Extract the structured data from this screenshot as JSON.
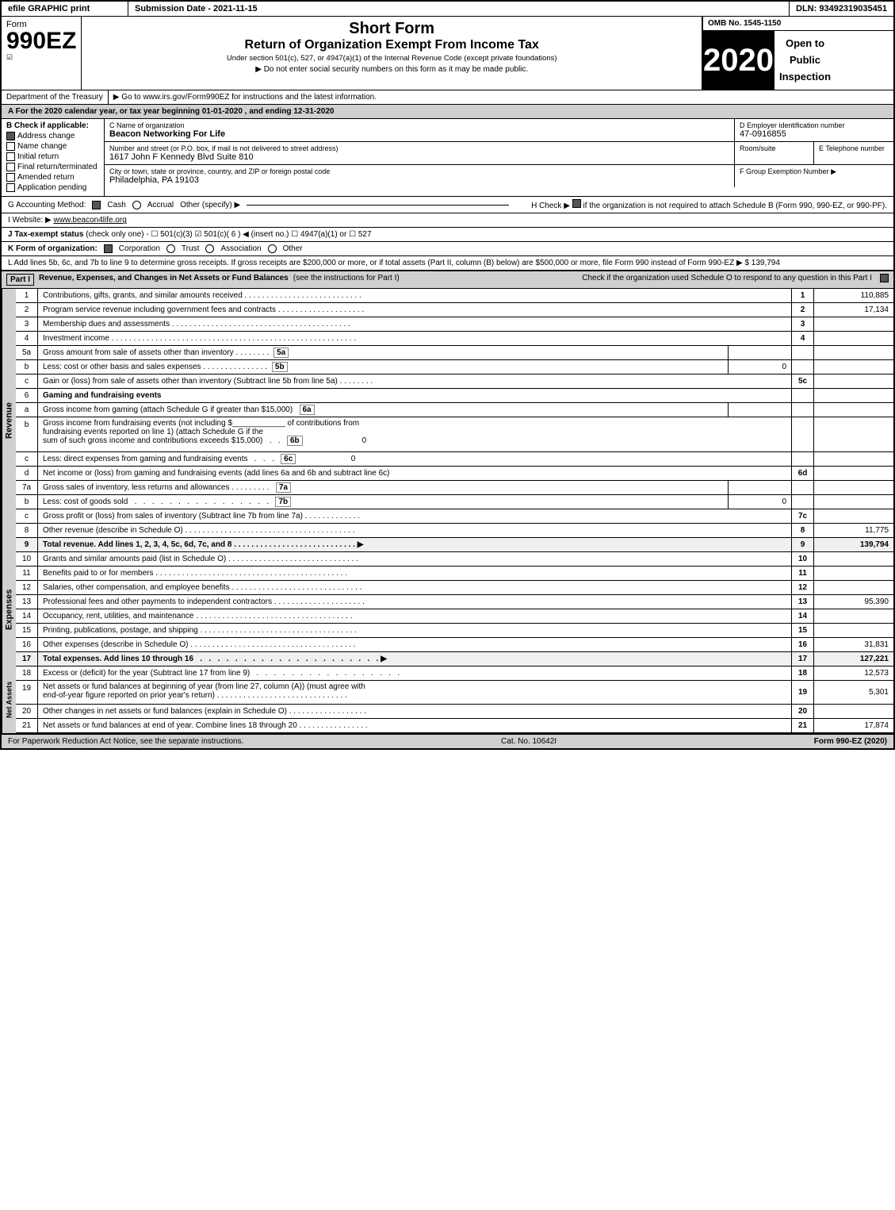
{
  "header": {
    "efile_label": "efile GRAPHIC print",
    "submission_label": "Submission Date - 2021-11-15",
    "dln_label": "DLN: 93492319035451"
  },
  "form": {
    "number": "990EZ",
    "short_form": "Short Form",
    "subtitle": "Return of Organization Exempt From Income Tax",
    "under_section": "Under section 501(c), 527, or 4947(a)(1) of the Internal Revenue Code (except private foundations)",
    "ssn_notice": "▶ Do not enter social security numbers on this form as it may be made public.",
    "instructions_link": "▶ Go to www.irs.gov/Form990EZ for instructions and the latest information.",
    "omb": "OMB No. 1545-1150",
    "year": "2020",
    "open_to_public": "Open to\nPublic\nInspection",
    "dept_treasury": "Department of the Treasury",
    "tax_year_line": "A For the 2020 calendar year, or tax year beginning 01-01-2020 , and ending 12-31-2020",
    "check_if": "B Check if applicable:",
    "address_change": "Address change",
    "name_change": "Name change",
    "initial_return": "Initial return",
    "final_return": "Final return/terminated",
    "amended_return": "Amended return",
    "application_pending": "Application pending",
    "c_name_label": "C Name of organization",
    "org_name": "Beacon Networking For Life",
    "d_ein_label": "D Employer identification number",
    "ein": "47-0916855",
    "address_label": "Number and street (or P.O. box, if mail is not delivered to street address)",
    "address_value": "1617 John F Kennedy Blvd Suite 810",
    "room_label": "Room/suite",
    "phone_label": "E Telephone number",
    "city_label": "City or town, state or province, country, and ZIP or foreign postal code",
    "city_value": "Philadelphia, PA  19103",
    "group_label": "F Group Exemption Number",
    "group_arrow": "▶",
    "accounting_label": "G Accounting Method:",
    "cash_label": "Cash",
    "accrual_label": "Accrual",
    "other_specify": "Other (specify) ▶",
    "h_check": "H Check ▶",
    "h_desc": "if the organization is not required to attach Schedule B (Form 990, 990-EZ, or 990-PF).",
    "website_label": "I Website: ▶",
    "website_value": "www.beacon4life.org",
    "tax_status_label": "J Tax-exempt status",
    "tax_status_desc": "(check only one) - ☐ 501(c)(3)  ☑ 501(c)( 6 ) ◀ (insert no.)  ☐ 4947(a)(1) or  ☐ 527",
    "form_org_label": "K Form of organization:",
    "corp_label": "Corporation",
    "trust_label": "Trust",
    "assoc_label": "Association",
    "other_label": "Other",
    "gross_receipt_line": "L Add lines 5b, 6c, and 7b to line 9 to determine gross receipts. If gross receipts are $200,000 or more, or if total assets (Part II, column (B) below) are $500,000 or more, file Form 990 instead of Form 990-EZ",
    "gross_receipt_amount": "▶ $ 139,794"
  },
  "part1": {
    "title": "Part I",
    "title_desc": "Revenue, Expenses, and Changes in Net Assets or Fund Balances",
    "title_see": "(see the instructions for Part I)",
    "schedule_o_check": "Check if the organization used Schedule O to respond to any question in this Part I",
    "lines": [
      {
        "num": "1",
        "desc": "Contributions, gifts, grants, and similar amounts received . . . . . . . . . . . . . . . . . . . . . . . . . . .",
        "line_ref": "1",
        "amount": "110,885"
      },
      {
        "num": "2",
        "desc": "Program service revenue including government fees and contracts . . . . . . . . . . . . . . . . . . . .",
        "line_ref": "2",
        "amount": "17,134"
      },
      {
        "num": "3",
        "desc": "Membership dues and assessments . . . . . . . . . . . . . . . . . . . . . . . . . . . . . . . . . . . . . . . . .",
        "line_ref": "3",
        "amount": ""
      },
      {
        "num": "4",
        "desc": "Investment income . . . . . . . . . . . . . . . . . . . . . . . . . . . . . . . . . . . . . . . . . . . . . . . . . . . . . . . .",
        "line_ref": "4",
        "amount": ""
      },
      {
        "num": "5a",
        "sub": "5a",
        "desc": "Gross amount from sale of assets other than inventory . . . . . . . .",
        "sub_amount": "",
        "line_ref": "",
        "amount": ""
      },
      {
        "num": "b",
        "sub": "5b",
        "desc": "Less: cost or other basis and sales expenses . . . . . . . . . . . . . . .",
        "sub_amount": "0",
        "line_ref": "",
        "amount": ""
      },
      {
        "num": "c",
        "desc": "Gain or (loss) from sale of assets other than inventory (Subtract line 5b from line 5a) . . . . . . . .",
        "line_ref": "5c",
        "amount": ""
      },
      {
        "num": "6",
        "desc": "Gaming and fundraising events",
        "line_ref": "",
        "amount": ""
      },
      {
        "num": "a",
        "sub": "6a",
        "desc": "Gross income from gaming (attach Schedule G if greater than $15,000)",
        "sub_amount": "",
        "line_ref": "",
        "amount": ""
      },
      {
        "num": "b",
        "desc": "Gross income from fundraising events (not including $____________ of contributions from fundraising events reported on line 1) (attach Schedule G if the sum of such gross income and contributions exceeds $15,000)   .   .",
        "sub": "6b",
        "sub_amount": "0",
        "line_ref": "",
        "amount": ""
      },
      {
        "num": "c",
        "sub": "6c",
        "desc": "Less: direct expenses from gaming and fundraising events   .   .   .",
        "sub_amount": "0",
        "line_ref": "",
        "amount": ""
      },
      {
        "num": "d",
        "desc": "Net income or (loss) from gaming and fundraising events (add lines 6a and 6b and subtract line 6c)",
        "line_ref": "6d",
        "amount": ""
      },
      {
        "num": "7a",
        "sub": "7a",
        "desc": "Gross sales of inventory, less returns and allowances . . . . . . . . .",
        "sub_amount": "",
        "line_ref": "",
        "amount": ""
      },
      {
        "num": "b",
        "sub": "7b",
        "desc": "Less: cost of goods sold    .   .   .   .   .   .   .   .   .   .   .   .   .   .   .   .   .   .",
        "sub_amount": "0",
        "line_ref": "",
        "amount": ""
      },
      {
        "num": "c",
        "desc": "Gross profit or (loss) from sales of inventory (Subtract line 7b from line 7a)  . . . . . . . . . . . . .",
        "line_ref": "7c",
        "amount": ""
      },
      {
        "num": "8",
        "desc": "Other revenue (describe in Schedule O) . . . . . . . . . . . . . . . . . . . . . . . . . . . . . . . . . . . . . . .",
        "line_ref": "8",
        "amount": "11,775"
      },
      {
        "num": "9",
        "desc": "Total revenue. Add lines 1, 2, 3, 4, 5c, 6d, 7c, and 8  . . . . . . . . . . . . . . . . . . . . . . . . . . . .",
        "line_ref": "9",
        "amount": "139,794",
        "bold": true
      }
    ]
  },
  "expenses": {
    "lines": [
      {
        "num": "10",
        "desc": "Grants and similar amounts paid (list in Schedule O) . . . . . . . . . . . . . . . . . . . . . . . . . . . . . .",
        "line_ref": "10",
        "amount": ""
      },
      {
        "num": "11",
        "desc": "Benefits paid to or for members  . . . . . . . . . . . . . . . . . . . . . . . . . . . . . . . . . . . . . . . . . . . .",
        "line_ref": "11",
        "amount": ""
      },
      {
        "num": "12",
        "desc": "Salaries, other compensation, and employee benefits . . . . . . . . . . . . . . . . . . . . . . . . . . . . . .",
        "line_ref": "12",
        "amount": ""
      },
      {
        "num": "13",
        "desc": "Professional fees and other payments to independent contractors . . . . . . . . . . . . . . . . . . . . .",
        "line_ref": "13",
        "amount": "95,390"
      },
      {
        "num": "14",
        "desc": "Occupancy, rent, utilities, and maintenance . . . . . . . . . . . . . . . . . . . . . . . . . . . . . . . . . . . .",
        "line_ref": "14",
        "amount": ""
      },
      {
        "num": "15",
        "desc": "Printing, publications, postage, and shipping . . . . . . . . . . . . . . . . . . . . . . . . . . . . . . . . . . . .",
        "line_ref": "15",
        "amount": ""
      },
      {
        "num": "16",
        "desc": "Other expenses (describe in Schedule O) . . . . . . . . . . . . . . . . . . . . . . . . . . . . . . . . . . . . . .",
        "line_ref": "16",
        "amount": "31,831"
      },
      {
        "num": "17",
        "desc": "Total expenses. Add lines 10 through 16    .   .   .   .   .   .   .   .   .   .   .   .   .   .   .   .   .   .   .   .   .   .   .   .",
        "line_ref": "17",
        "amount": "127,221",
        "bold": true,
        "arrow": "▶"
      }
    ]
  },
  "net_assets_changes": {
    "lines": [
      {
        "num": "18",
        "desc": "Excess or (deficit) for the year (Subtract line 17 from line 9)   .   .   .   .   .   .   .   .   .   .   .   .   .   .   .   .   .   .",
        "line_ref": "18",
        "amount": "12,573"
      },
      {
        "num": "19",
        "desc": "Net assets or fund balances at beginning of year (from line 27, column (A)) (must agree with end-of-year figure reported on prior year's return) . . . . . . . . . . . . . . . . . . . . . . . . . . . . . .",
        "line_ref": "19",
        "amount": "5,301"
      },
      {
        "num": "20",
        "desc": "Other changes in net assets or fund balances (explain in Schedule O) . . . . . . . . . . . . . . . . . .",
        "line_ref": "20",
        "amount": ""
      },
      {
        "num": "21",
        "desc": "Net assets or fund balances at end of year. Combine lines 18 through 20 . . . . . . . . . . . . . . . .",
        "line_ref": "21",
        "amount": "17,874"
      }
    ]
  },
  "footer": {
    "paperwork_notice": "For Paperwork Reduction Act Notice, see the separate instructions.",
    "cat_no": "Cat. No. 10642I",
    "form_ref": "Form 990-EZ (2020)"
  }
}
